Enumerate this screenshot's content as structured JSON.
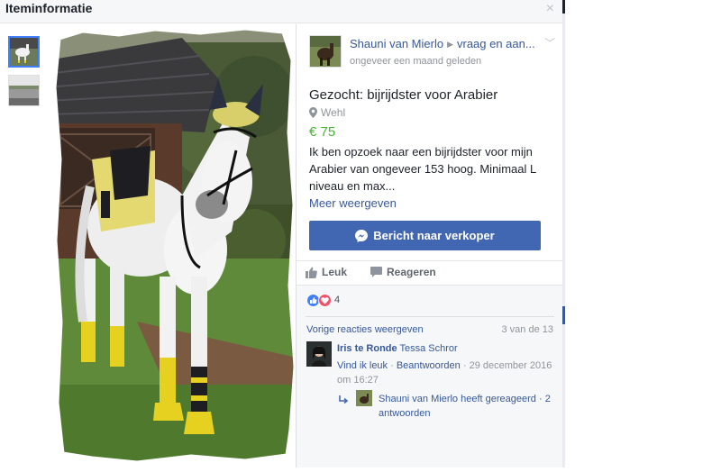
{
  "header": {
    "title": "Iteminformatie",
    "close_glyph": "×"
  },
  "thumbnails": [
    {
      "name": "horse-photo-thumb",
      "selected": true
    },
    {
      "name": "arena-photo-thumb",
      "selected": false
    }
  ],
  "seller": {
    "name": "Shauni van Mierlo",
    "group": "vraag en aan...",
    "time": "ongeveer een maand geleden"
  },
  "listing": {
    "title": "Gezocht: bijrijdster voor Arabier",
    "location": "Wehl",
    "price": "€ 75",
    "description": "Ik ben opzoek naar een bijrijdster voor mijn Arabier van ongeveer 153 hoog. Minimaal L niveau en max...",
    "more_label": "Meer weergeven"
  },
  "message_button": {
    "label": "Bericht naar verkoper"
  },
  "actions": {
    "like_label": "Leuk",
    "comment_label": "Reageren"
  },
  "reactions": {
    "count": "4"
  },
  "comments": {
    "previous_label": "Vorige reacties weergeven",
    "count_label": "3 van de 13",
    "items": [
      {
        "author": "Iris te Ronde",
        "tagged": "Tessa Schror",
        "like_label": "Vind ik leuk",
        "separator": " · ",
        "reply_label": "Beantwoorden",
        "timestamp": "· 29 december 2016 om 16:27"
      }
    ],
    "reply_summary": {
      "text": "Shauni van Mierlo heeft gereageerd",
      "count": "· 2 antwoorden"
    }
  },
  "colors": {
    "link": "#365899",
    "price": "#42b72a",
    "button": "#4267b2",
    "like_reaction": "#4080ff",
    "love_reaction": "#f25268"
  },
  "icons": [
    "close-icon",
    "chevron-down-icon",
    "location-pin-icon",
    "messenger-icon",
    "thumbs-up-icon",
    "comment-icon",
    "reply-arrow-icon"
  ]
}
